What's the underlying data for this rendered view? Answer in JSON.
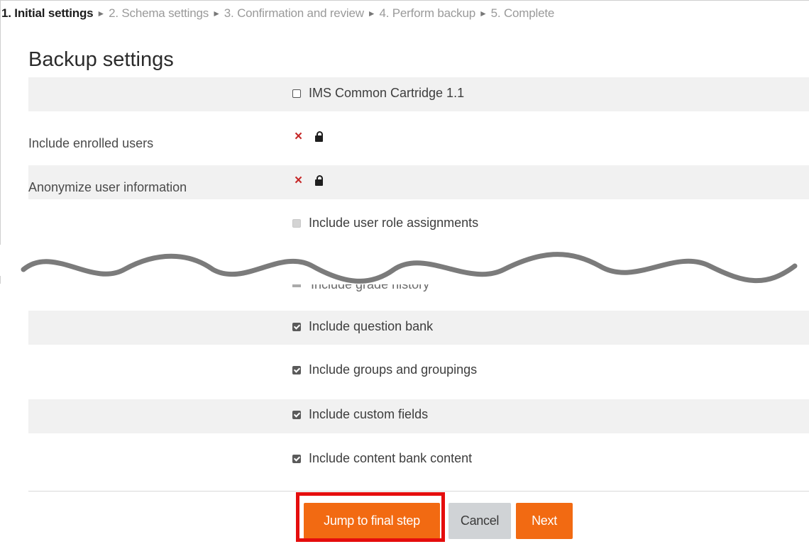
{
  "progress": {
    "steps": [
      "1. Initial settings",
      "2. Schema settings",
      "3. Confirmation and review",
      "4. Perform backup",
      "5. Complete"
    ],
    "current_index": 0
  },
  "title": "Backup settings",
  "settings": {
    "ims_cc": "IMS Common Cartridge 1.1",
    "enrolled_users_label": "Include enrolled users",
    "anonymize_label": "Anonymize user information",
    "role_assignments": "Include user role assignments",
    "grade_history_partial": "Include grade history",
    "question_bank": "Include question bank",
    "groups": "Include groups and groupings",
    "custom_fields": "Include custom fields",
    "content_bank": "Include content bank content"
  },
  "icons": {
    "cross": "×",
    "lock": "lock-icon"
  },
  "buttons": {
    "jump": "Jump to final step",
    "cancel": "Cancel",
    "next": "Next"
  },
  "colors": {
    "accent": "#f26a12",
    "highlight": "#e50d0d",
    "cross": "#c62828"
  }
}
